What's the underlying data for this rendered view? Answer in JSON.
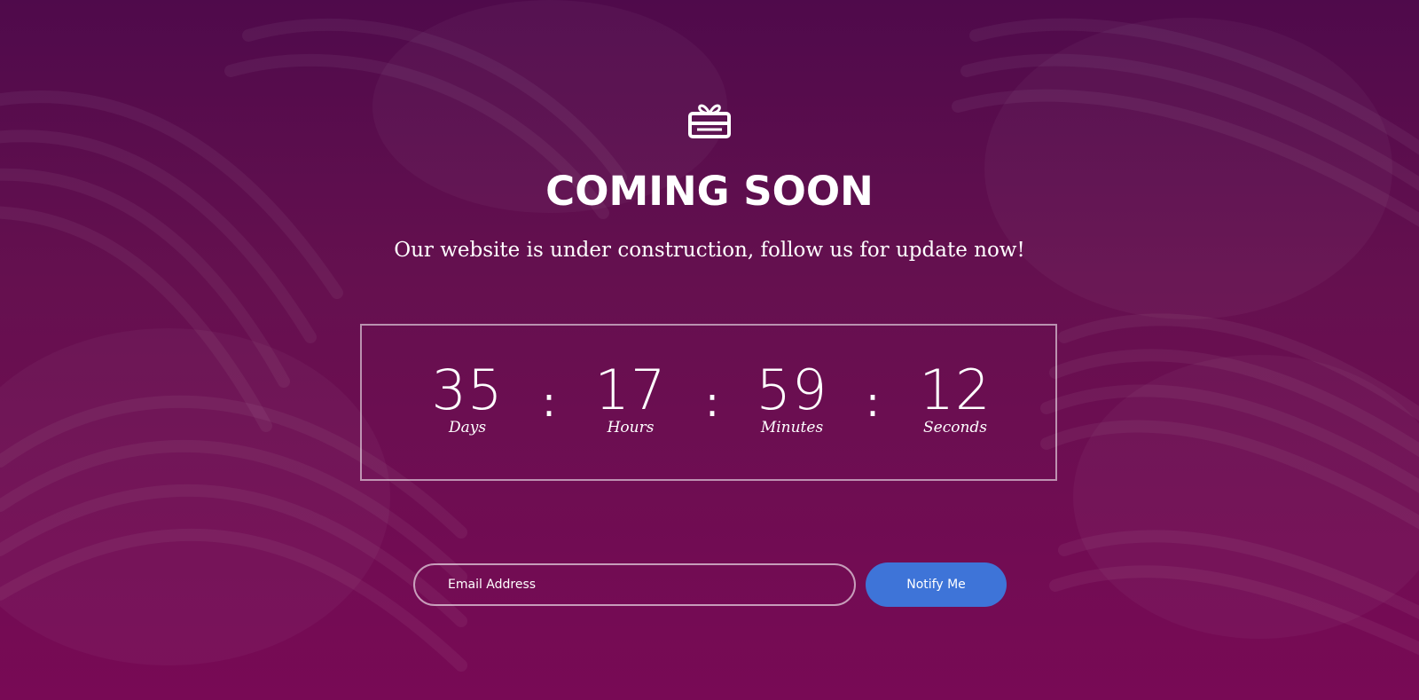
{
  "hero": {
    "icon": "gift-icon",
    "title": "COMING SOON",
    "subtitle": "Our website is under construction, follow us for update now!"
  },
  "countdown": {
    "days": {
      "value": "35",
      "label": "Days"
    },
    "hours": {
      "value": "17",
      "label": "Hours"
    },
    "minutes": {
      "value": "59",
      "label": "Minutes"
    },
    "seconds": {
      "value": "12",
      "label": "Seconds"
    },
    "separator": ":"
  },
  "subscribe": {
    "email_placeholder": "Email Address",
    "email_value": "",
    "button_label": "Notify Me"
  },
  "colors": {
    "background_top": "#4f0a4b",
    "background_bottom": "#780a55",
    "button": "#3e74d8",
    "text": "#ffffff"
  }
}
